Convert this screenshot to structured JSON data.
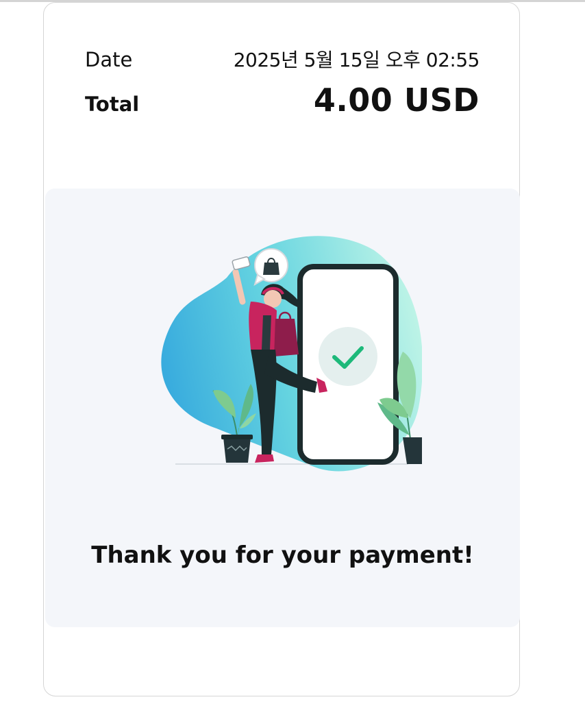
{
  "receipt": {
    "date_label": "Date",
    "date_value": "2025년 5월 15일 오후 02:55",
    "total_label": "Total",
    "total_value": "4.00 USD"
  },
  "confirmation": {
    "message": "Thank you for your payment!",
    "illustration": "payment-success-illustration"
  },
  "colors": {
    "accent_green": "#1db97a",
    "blob_blue": "#2fa8dc",
    "blob_mint": "#9ef0d6",
    "phone_dark": "#1c2b2d",
    "shirt_pink": "#c8245e",
    "panel_bg": "#f4f6fa"
  }
}
